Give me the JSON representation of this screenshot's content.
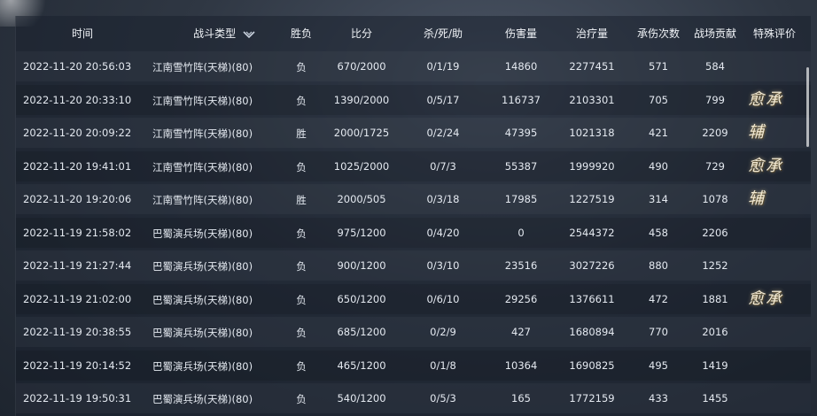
{
  "title": "",
  "columns": {
    "time": "时间",
    "battle_type": "战斗类型",
    "result": "胜负",
    "score": "比分",
    "kda": "杀/死/助",
    "damage": "伤害量",
    "healing": "治疗量",
    "damage_taken_count": "承伤次数",
    "contribution": "战场贡献",
    "special_rating": "特殊评价"
  },
  "rows": [
    {
      "time": "2022-11-20 20:56:03",
      "type": "江南雪竹阵(天梯)(80)",
      "result": "负",
      "score": "670/2000",
      "kda": "0/1/19",
      "damage": "14860",
      "healing": "2277451",
      "taken": "571",
      "contribution": "584",
      "rating": ""
    },
    {
      "time": "2022-11-20 20:33:10",
      "type": "江南雪竹阵(天梯)(80)",
      "result": "负",
      "score": "1390/2000",
      "kda": "0/5/17",
      "damage": "116737",
      "healing": "2103301",
      "taken": "705",
      "contribution": "799",
      "rating": "愈承"
    },
    {
      "time": "2022-11-20 20:09:22",
      "type": "江南雪竹阵(天梯)(80)",
      "result": "胜",
      "score": "2000/1725",
      "kda": "0/2/24",
      "damage": "47395",
      "healing": "1021318",
      "taken": "421",
      "contribution": "2209",
      "rating": "辅"
    },
    {
      "time": "2022-11-20 19:41:01",
      "type": "江南雪竹阵(天梯)(80)",
      "result": "负",
      "score": "1025/2000",
      "kda": "0/7/3",
      "damage": "55387",
      "healing": "1999920",
      "taken": "490",
      "contribution": "729",
      "rating": "愈承"
    },
    {
      "time": "2022-11-20 19:20:06",
      "type": "江南雪竹阵(天梯)(80)",
      "result": "胜",
      "score": "2000/505",
      "kda": "0/3/18",
      "damage": "17985",
      "healing": "1227519",
      "taken": "314",
      "contribution": "1078",
      "rating": "辅"
    },
    {
      "time": "2022-11-19 21:58:02",
      "type": "巴蜀演兵场(天梯)(80)",
      "result": "负",
      "score": "975/1200",
      "kda": "0/4/20",
      "damage": "0",
      "healing": "2544372",
      "taken": "458",
      "contribution": "2206",
      "rating": ""
    },
    {
      "time": "2022-11-19 21:27:44",
      "type": "巴蜀演兵场(天梯)(80)",
      "result": "负",
      "score": "900/1200",
      "kda": "0/3/10",
      "damage": "23516",
      "healing": "3027226",
      "taken": "880",
      "contribution": "1252",
      "rating": ""
    },
    {
      "time": "2022-11-19 21:02:00",
      "type": "巴蜀演兵场(天梯)(80)",
      "result": "负",
      "score": "650/1200",
      "kda": "0/6/10",
      "damage": "29256",
      "healing": "1376611",
      "taken": "472",
      "contribution": "1881",
      "rating": "愈承"
    },
    {
      "time": "2022-11-19 20:38:55",
      "type": "巴蜀演兵场(天梯)(80)",
      "result": "负",
      "score": "685/1200",
      "kda": "0/2/9",
      "damage": "427",
      "healing": "1680894",
      "taken": "770",
      "contribution": "2016",
      "rating": ""
    },
    {
      "time": "2022-11-19 20:14:52",
      "type": "巴蜀演兵场(天梯)(80)",
      "result": "负",
      "score": "465/1200",
      "kda": "0/1/8",
      "damage": "10364",
      "healing": "1690825",
      "taken": "495",
      "contribution": "1419",
      "rating": ""
    },
    {
      "time": "2022-11-19 19:50:31",
      "type": "巴蜀演兵场(天梯)(80)",
      "result": "负",
      "score": "540/1200",
      "kda": "0/5/3",
      "damage": "165",
      "healing": "1772159",
      "taken": "433",
      "contribution": "1455",
      "rating": ""
    }
  ],
  "icons": {
    "sort": "chevron-down-icon"
  }
}
